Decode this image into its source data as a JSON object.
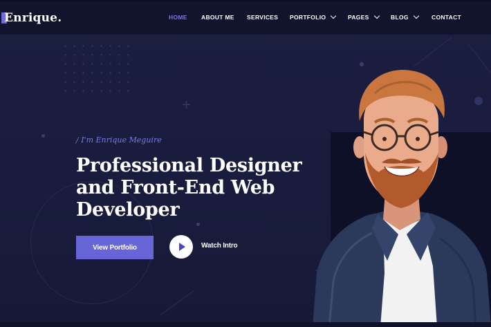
{
  "brand": {
    "logo_text": "Enrique.",
    "accent": "#6e6bde"
  },
  "nav": {
    "items": [
      {
        "label": "HOME",
        "active": true,
        "dropdown": false
      },
      {
        "label": "ABOUT ME",
        "active": false,
        "dropdown": false
      },
      {
        "label": "SERVICES",
        "active": false,
        "dropdown": false
      },
      {
        "label": "PORTFOLIO",
        "active": false,
        "dropdown": true
      },
      {
        "label": "PAGES",
        "active": false,
        "dropdown": true
      },
      {
        "label": "BLOG",
        "active": false,
        "dropdown": true
      },
      {
        "label": "CONTACT",
        "active": false,
        "dropdown": false
      }
    ]
  },
  "hero": {
    "kicker": "/ I'm Enrique Meguire",
    "headline": [
      "Professional Designer",
      "and Front-End Web",
      "Developer"
    ],
    "primary_button": "View Portfolio",
    "secondary_button": "Watch Intro",
    "play_icon": "play-icon"
  },
  "colors": {
    "background": "#1b1e40",
    "header": "#11142c",
    "accent": "#6865d6",
    "active_nav": "#7b78ea"
  }
}
